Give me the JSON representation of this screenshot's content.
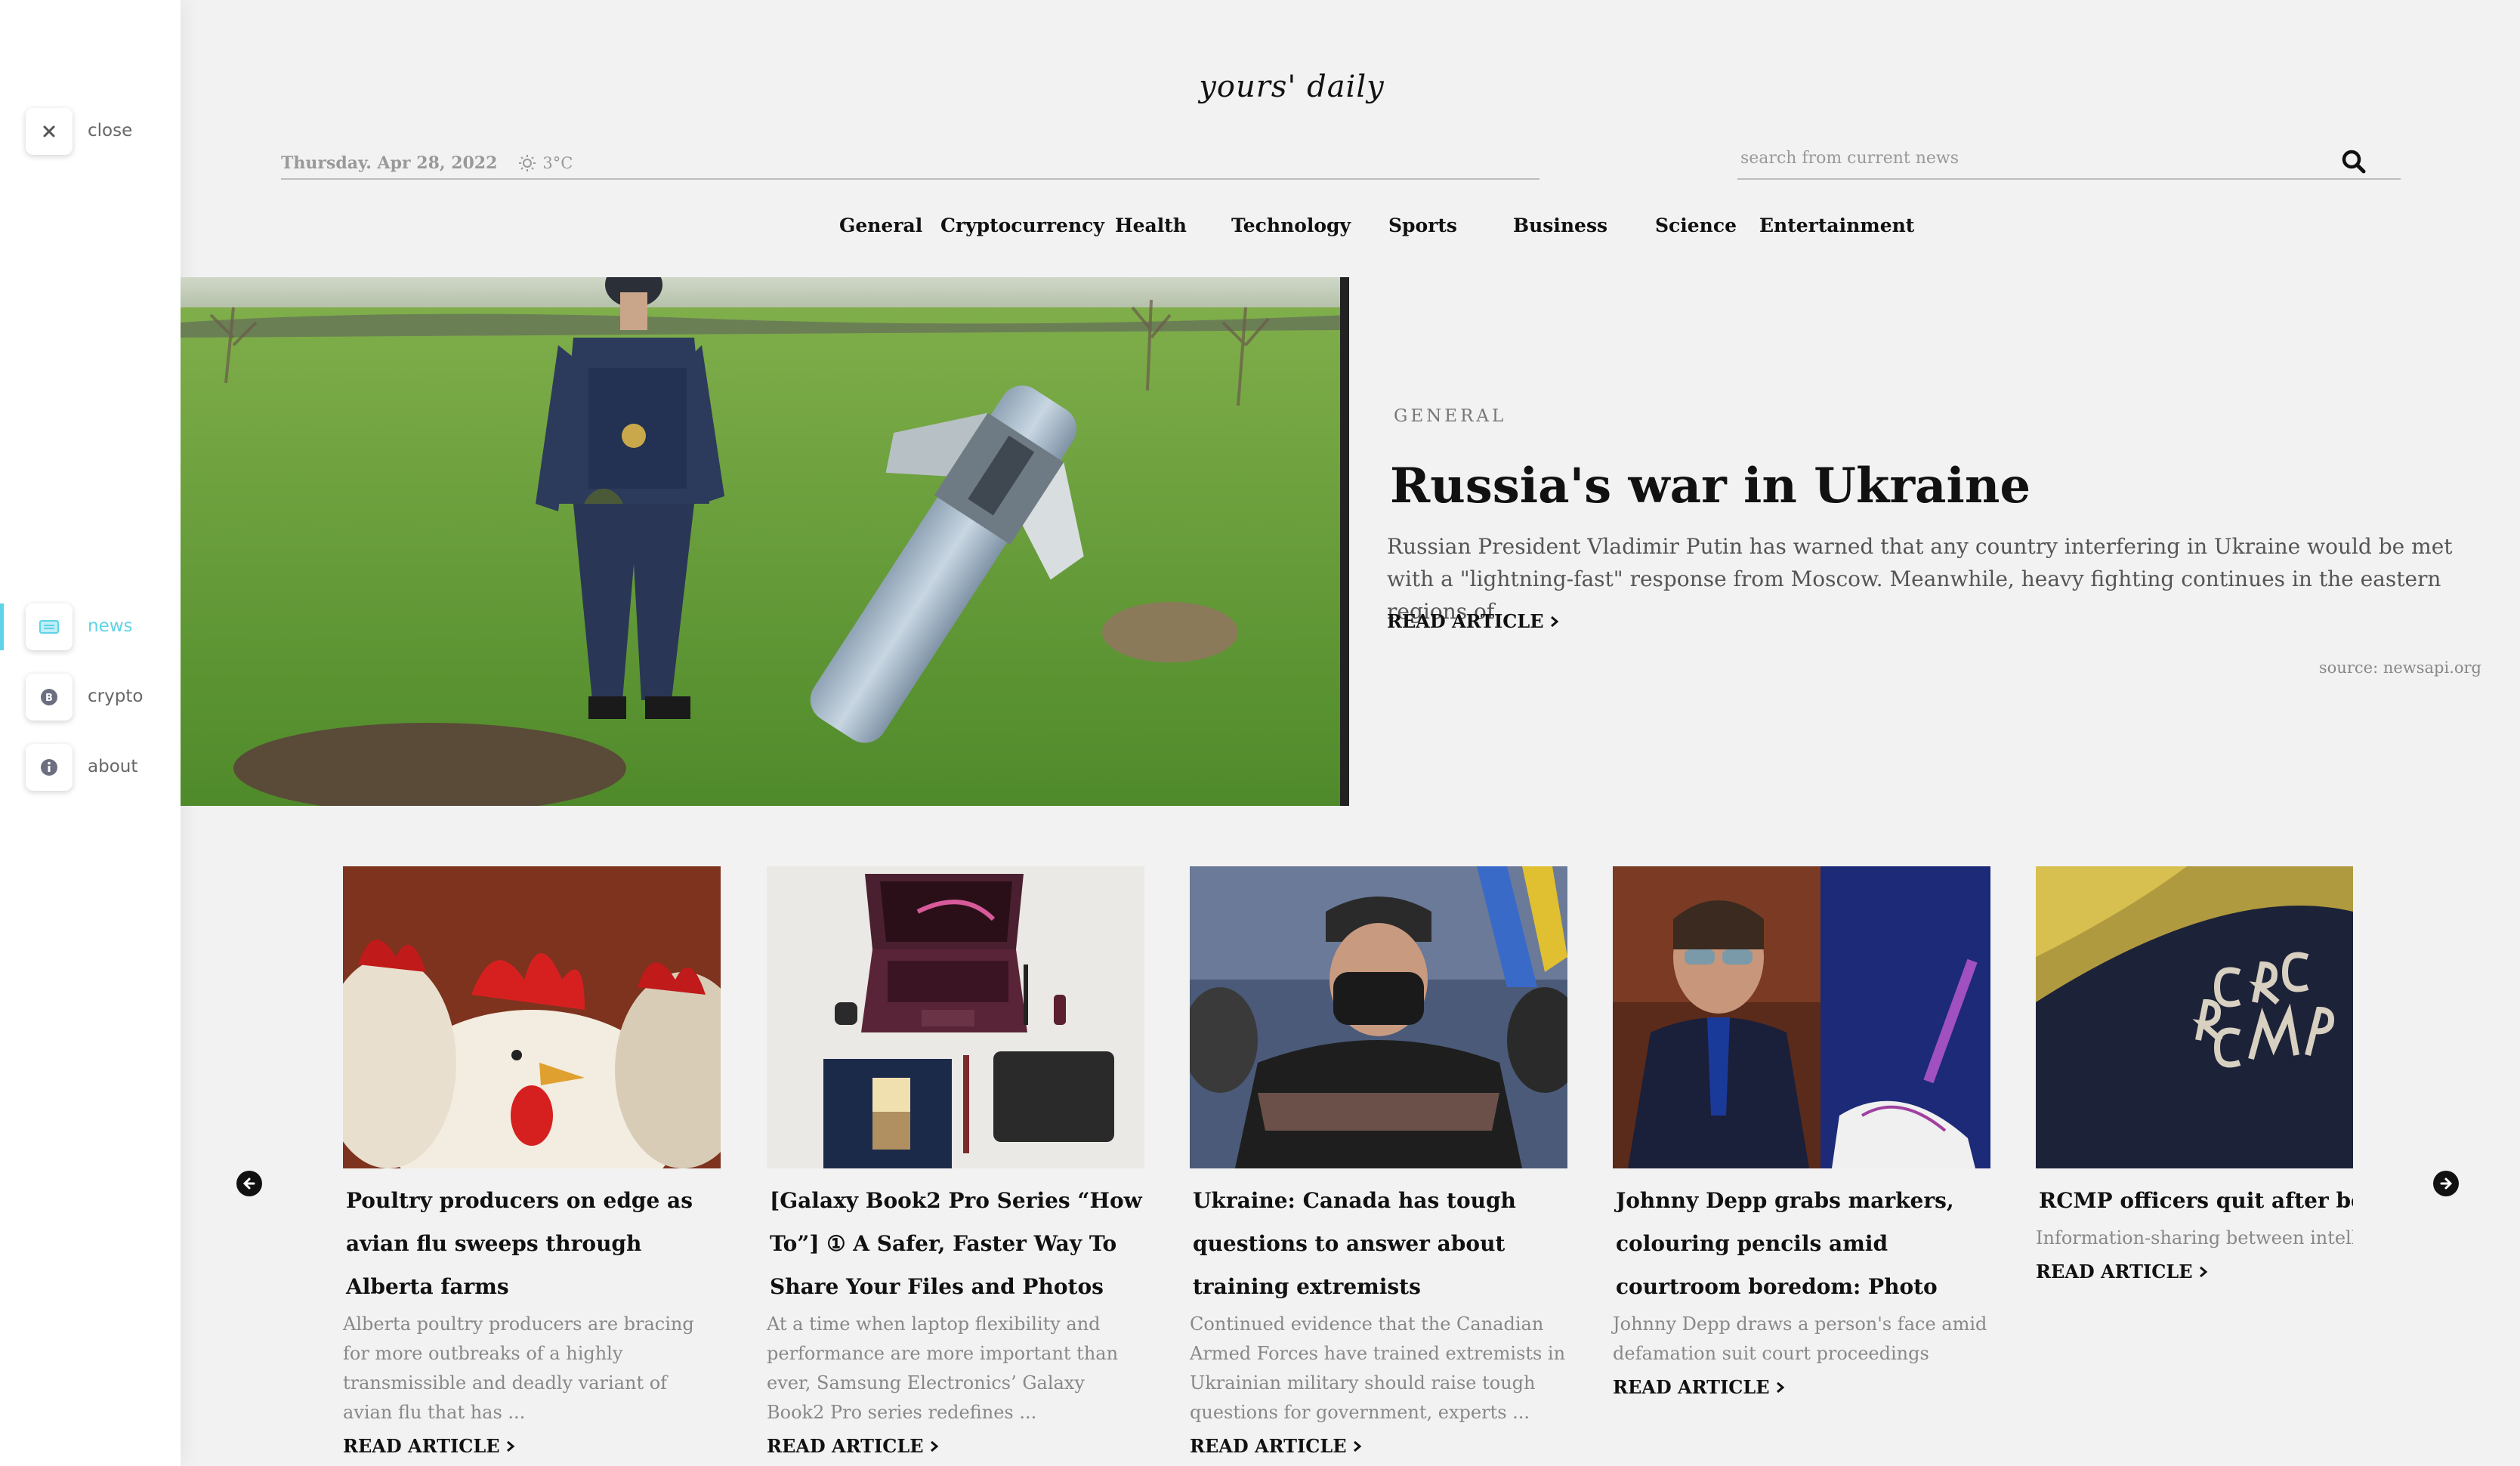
{
  "sidebar": {
    "close_label": "close",
    "items": [
      {
        "label": "news",
        "icon": "newspaper-icon",
        "active": true
      },
      {
        "label": "crypto",
        "icon": "bitcoin-icon",
        "active": false
      },
      {
        "label": "about",
        "icon": "info-icon",
        "active": false
      }
    ]
  },
  "header": {
    "brand": "yours' daily",
    "date": "Thursday. Apr 28, 2022",
    "weather": "3°C",
    "search_placeholder": "search from current news",
    "search_value": ""
  },
  "nav": [
    "General",
    "Cryptocurrency",
    "Health",
    "Technology",
    "Sports",
    "Business",
    "Science",
    "Entertainment"
  ],
  "hero": {
    "category": "GENERAL",
    "title": "Russia's war in Ukraine",
    "description": "Russian President Vladimir Putin has warned that any country interfering in Ukraine would be met with a \"lightning-fast\" response from Moscow. Meanwhile, heavy fighting continues in the eastern regions of",
    "read_label": "READ ARTICLE",
    "source": "source: newsapi.org"
  },
  "cards": [
    {
      "title": "Poultry producers on edge as avian flu sweeps through Alberta farms",
      "description": "Alberta poultry producers are bracing for more outbreaks of a highly transmissible and deadly variant of avian flu that has ...",
      "read_label": "READ ARTICLE"
    },
    {
      "title": "[Galaxy Book2 Pro Series “How To”] ① A Safer, Faster Way To Share Your Files and Photos",
      "description": "At a time when laptop flexibility and performance are more important than ever, Samsung Electronics’ Galaxy Book2 Pro series redefines ...",
      "read_label": "READ ARTICLE"
    },
    {
      "title": "Ukraine: Canada has tough questions to answer about training extremists",
      "description": "Continued evidence that the Canadian Armed Forces have trained extremists in Ukrainian military should raise tough questions for government, experts ...",
      "read_label": "READ ARTICLE"
    },
    {
      "title": "Johnny Depp grabs markers, colouring pencils amid courtroom boredom: Photo",
      "description": "Johnny Depp draws a person's face amid defamation suit court proceedings",
      "read_label": "READ ARTICLE"
    },
    {
      "title": "RCMP officers quit after being asked to arrest national security targets with no details, report says",
      "description": "Information-sharing between intelligence officers and police needs an overhaul – could start with informing police of the reasons behind national security arrests",
      "read_label": "READ ARTICLE"
    }
  ],
  "colors": {
    "accent": "#5fd3e8",
    "background": "#f2f2f2",
    "text": "#111111",
    "muted": "#888888"
  }
}
